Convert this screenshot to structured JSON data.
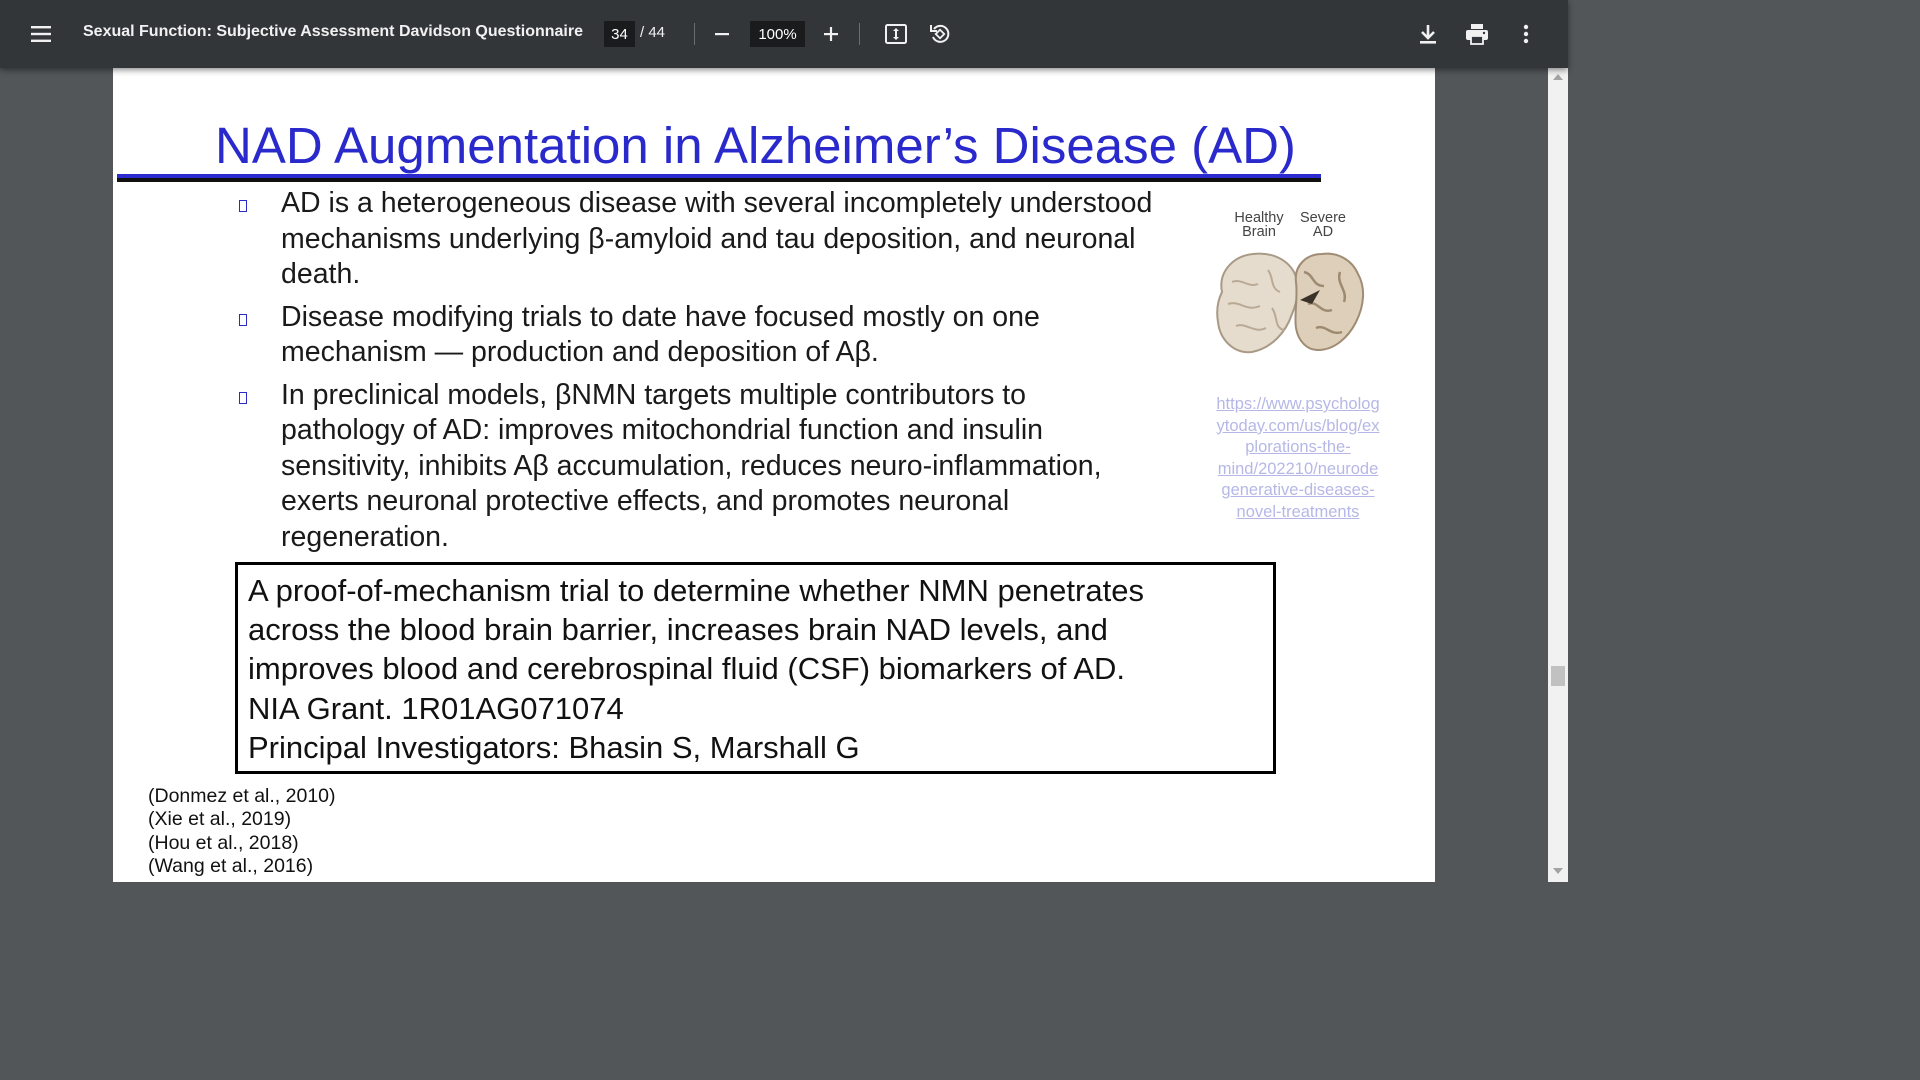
{
  "toolbar": {
    "menu_icon": "hamburger-menu-icon",
    "title": "Sexual Function: Subjective Assessment Davidson Questionnaire",
    "current_page": "34",
    "page_separator": "/ 44",
    "zoom_out_icon": "minus-icon",
    "zoom_level": "100%",
    "zoom_in_icon": "plus-icon",
    "fit_icon": "fit-to-page-icon",
    "rotate_icon": "rotate-icon",
    "download_icon": "download-icon",
    "print_icon": "print-icon",
    "more_icon": "more-vertical-icon"
  },
  "slide": {
    "title": "NAD Augmentation in Alzheimer’s Disease (AD)",
    "bullets": [
      {
        "lines": [
          "AD is a heterogeneous disease with several incompletely understood",
          "mechanisms underlying β-amyloid and tau deposition, and neuronal",
          "death."
        ]
      },
      {
        "lines": [
          "Disease modifying trials to date have focused mostly on one",
          "mechanism — production and deposition of Aβ."
        ]
      },
      {
        "lines": [
          "In preclinical models, βNMN targets multiple contributors to",
          "pathology of AD: improves mitochondrial function and insulin",
          "sensitivity, inhibits Aβ accumulation, reduces neuro-inflammation,",
          "exerts neuronal protective effects, and promotes neuronal",
          "regeneration."
        ]
      }
    ],
    "figure": {
      "label_healthy": [
        "Healthy",
        "Brain"
      ],
      "label_severe": [
        "Severe",
        "AD"
      ]
    },
    "source_link": [
      "https://www.psycholog",
      "ytoday.com/us/blog/ex",
      "plorations-the-",
      "mind/202210/neurode",
      "generative-diseases-",
      "novel-treatments"
    ],
    "trial_box": [
      "A proof-of-mechanism trial to determine whether NMN penetrates",
      "across the blood brain barrier, increases brain NAD levels, and",
      "improves blood and cerebrospinal fluid (CSF) biomarkers of AD.",
      "NIA Grant. 1R01AG071074",
      "Principal Investigators: Bhasin S, Marshall G"
    ],
    "references": [
      "(Donmez et al., 2010)",
      "(Xie et al., 2019)",
      "(Hou et al., 2018)",
      "(Wang et al., 2016)"
    ]
  },
  "colors": {
    "toolbar_bg": "#323639",
    "viewer_bg": "#525659",
    "title_blue": "#2a2acc",
    "link_color": "#b5b8e6"
  }
}
